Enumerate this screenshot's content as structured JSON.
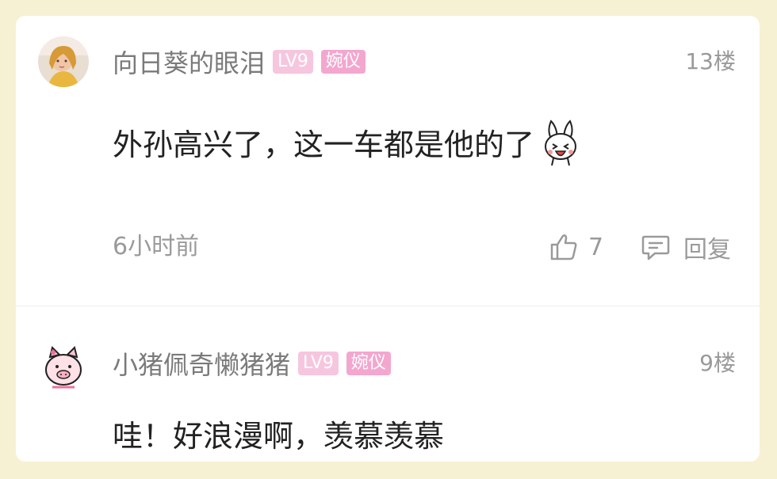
{
  "comments": [
    {
      "username": "向日葵的眼泪",
      "level": "LV9",
      "title": "婉仪",
      "floor": "13楼",
      "text": "外孙高兴了，这一车都是他的了",
      "emoji": "bunny-emoji",
      "time": "6小时前",
      "likes": "7",
      "reply_label": "回复"
    },
    {
      "username": "小猪佩奇懒猪猪",
      "level": "LV9",
      "title": "婉仪",
      "floor": "9楼",
      "text": "哇！好浪漫啊，羡慕羡慕"
    }
  ],
  "colors": {
    "page_background": "#f7f1d3",
    "card_background": "#ffffff",
    "username": "#7a7a7a",
    "meta_text": "#9a9a9a",
    "level_badge": "#f6c6df",
    "title_badge": "#f3a7cf",
    "comment_text": "#222222"
  }
}
